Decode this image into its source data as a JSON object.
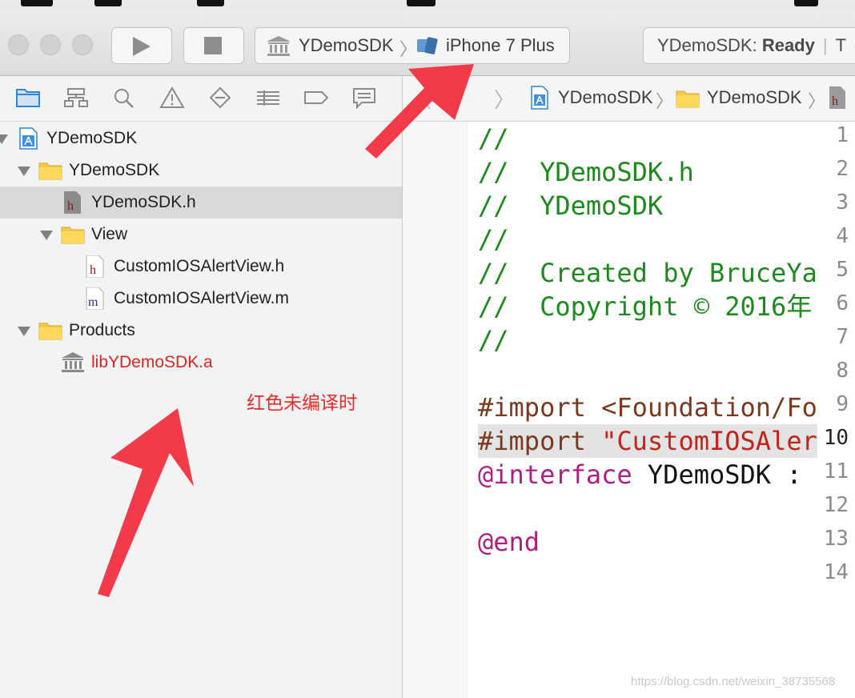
{
  "toolbar": {
    "scheme_project": "YDemoSDK",
    "scheme_device": "iPhone 7 Plus",
    "status_prefix": "YDemoSDK: ",
    "status_state": "Ready",
    "status_more": "T"
  },
  "navigator": {
    "tabs": [
      "folder-icon",
      "hierarchy-icon",
      "search-icon",
      "warning-icon",
      "breakpoint-icon",
      "list-icon",
      "tag-icon",
      "comment-icon"
    ],
    "rows": [
      {
        "label": "YDemoSDK",
        "kind": "project"
      },
      {
        "label": "YDemoSDK",
        "kind": "folder"
      },
      {
        "label": "YDemoSDK.h",
        "kind": "header",
        "selected": true
      },
      {
        "label": "View",
        "kind": "folder"
      },
      {
        "label": "CustomIOSAlertView.h",
        "kind": "header"
      },
      {
        "label": "CustomIOSAlertView.m",
        "kind": "impl"
      },
      {
        "label": "Products",
        "kind": "folder"
      },
      {
        "label": "libYDemoSDK.a",
        "kind": "library",
        "missing": true
      }
    ],
    "annotation": "红色未编译时"
  },
  "editor": {
    "breadcrumbs": [
      "YDemoSDK",
      "YDemoSDK"
    ],
    "line_numbers": [
      "1",
      "2",
      "3",
      "4",
      "5",
      "6",
      "7",
      "8",
      "9",
      "10",
      "11",
      "12",
      "13",
      "14"
    ],
    "current_line": "10",
    "lines": [
      "//",
      "//  YDemoSDK.h",
      "//  YDemoSDK",
      "//",
      "//  Created by BruceYa",
      "//  Copyright © 2016年",
      "//",
      "",
      "#import <Foundation/Fo",
      "#import \"CustomIOSAler",
      "@interface YDemoSDK :",
      "",
      "@end",
      ""
    ]
  },
  "watermark": "https://blog.csdn.net/weixin_38735568",
  "colors": {
    "arrow": "#f23a4b",
    "comment": "#1d8a1d",
    "preprocessor": "#7a3a1f",
    "string": "#c4231d",
    "keyword": "#ae1f84",
    "missing_file": "#e02424"
  }
}
